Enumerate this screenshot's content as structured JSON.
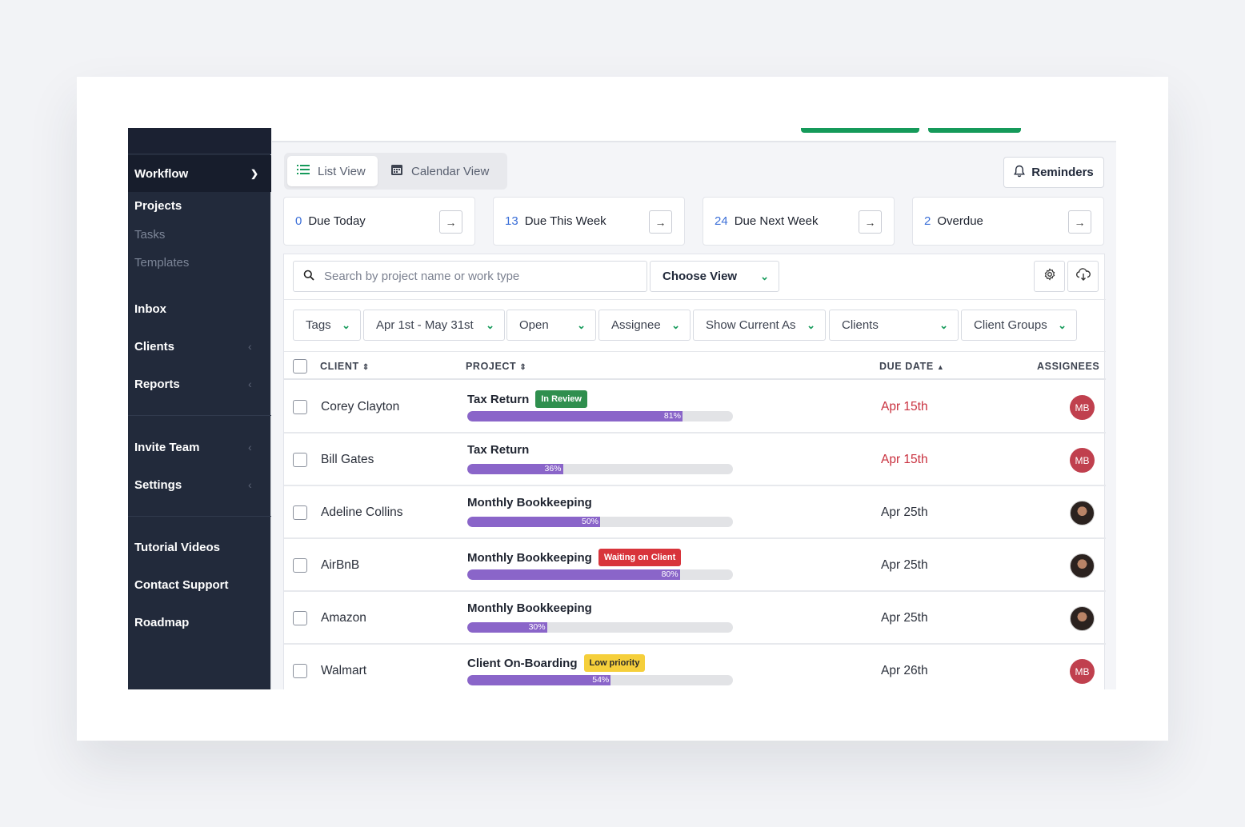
{
  "sidebar": {
    "section": "Workflow",
    "items": [
      {
        "label": "Projects"
      },
      {
        "label": "Tasks"
      },
      {
        "label": "Templates"
      }
    ],
    "main": [
      {
        "label": "Inbox"
      },
      {
        "label": "Clients"
      },
      {
        "label": "Reports"
      },
      {
        "label": "Invite Team"
      },
      {
        "label": "Settings"
      },
      {
        "label": "Tutorial Videos"
      },
      {
        "label": "Contact Support"
      },
      {
        "label": "Roadmap"
      }
    ]
  },
  "views": {
    "list_label": "List View",
    "calendar_label": "Calendar View",
    "reminders_label": "Reminders"
  },
  "stats": [
    {
      "count": "0",
      "label": "Due Today"
    },
    {
      "count": "13",
      "label": "Due This Week"
    },
    {
      "count": "24",
      "label": "Due Next Week"
    },
    {
      "count": "2",
      "label": "Overdue"
    }
  ],
  "search": {
    "placeholder": "Search by project name or work type"
  },
  "choose_view": "Choose View",
  "filters": [
    {
      "label": "Tags"
    },
    {
      "label": "Apr 1st - May 31st"
    },
    {
      "label": "Open"
    },
    {
      "label": "Assignee"
    },
    {
      "label": "Show Current As"
    },
    {
      "label": "Clients"
    },
    {
      "label": "Client Groups"
    }
  ],
  "table": {
    "columns": {
      "client": "CLIENT",
      "project": "PROJECT",
      "due": "DUE DATE",
      "assignees": "ASSIGNEES"
    },
    "rows": [
      {
        "client": "Corey Clayton",
        "project": "Tax Return",
        "tag": "In Review",
        "progress": "81%",
        "due": "Apr 15th",
        "assignee": "MB"
      },
      {
        "client": "Bill Gates",
        "project": "Tax Return",
        "tag": "",
        "progress": "36%",
        "due": "Apr 15th",
        "assignee": "MB"
      },
      {
        "client": "Adeline Collins",
        "project": "Monthly Bookkeeping",
        "tag": "",
        "progress": "50%",
        "due": "Apr 25th",
        "assignee": ""
      },
      {
        "client": "AirBnB",
        "project": "Monthly Bookkeeping",
        "tag": "Waiting on Client",
        "progress": "80%",
        "due": "Apr 25th",
        "assignee": ""
      },
      {
        "client": "Amazon",
        "project": "Monthly Bookkeeping",
        "tag": "",
        "progress": "30%",
        "due": "Apr 25th",
        "assignee": ""
      },
      {
        "client": "Walmart",
        "project": "Client On-Boarding",
        "tag": "Low priority",
        "progress": "54%",
        "due": "Apr 26th",
        "assignee": "MB"
      }
    ]
  },
  "colors": {
    "sidebar": "#222a3b",
    "accent_green": "#159a5a",
    "accent_blue": "#3b6fd8",
    "progress": "#8a65c9",
    "overdue_red": "#c9303e",
    "tag_review": "#2f8f4e",
    "tag_waiting": "#d8343b",
    "tag_low": "#f5cf3b"
  }
}
